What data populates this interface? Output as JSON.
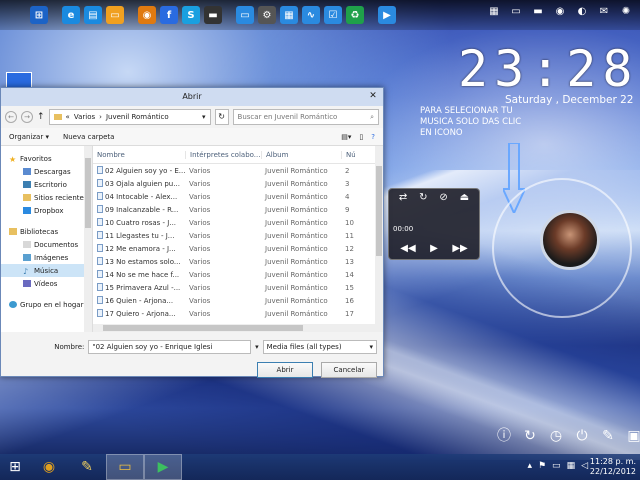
{
  "desktop": {
    "clock": "23:28",
    "date": "Saturday , December 22",
    "note_lines": [
      "PARA SELECIONAR TU",
      "MUSICA SOLO DAS CLIC",
      "EN ICONO"
    ]
  },
  "player": {
    "time": "00:00"
  },
  "dialog": {
    "title": "Abrir",
    "close": "✕",
    "address": {
      "root": "«",
      "path_1": "Varios",
      "path_2": "Juvenil Romántico"
    },
    "search_placeholder": "Buscar en Juvenil Romántico",
    "toolbar": {
      "organize": "Organizar ▾",
      "new_folder": "Nueva carpeta"
    },
    "nav": {
      "favorites": "Favoritos",
      "downloads": "Descargas",
      "desktop": "Escritorio",
      "recent": "Sitios recientes",
      "dropbox": "Dropbox",
      "libraries": "Bibliotecas",
      "documents": "Documentos",
      "images": "Imágenes",
      "music": "Música",
      "videos": "Vídeos",
      "homegroup": "Grupo en el hogar"
    },
    "columns": {
      "name": "Nombre",
      "artists": "Intérpretes colabo...",
      "album": "Álbum",
      "num": "Nú"
    },
    "files": [
      {
        "name": "02 Alguien soy yo - E...",
        "artist": "Varios",
        "album": "Juvenil Romántico",
        "num": "2"
      },
      {
        "name": "03 Ojala alguien pu...",
        "artist": "Varios",
        "album": "Juvenil Romántico",
        "num": "3"
      },
      {
        "name": "04 Intocable - Alex...",
        "artist": "Varios",
        "album": "Juvenil Romántico",
        "num": "4"
      },
      {
        "name": "09 Inalcanzable - R...",
        "artist": "Varios",
        "album": "Juvenil Romántico",
        "num": "9"
      },
      {
        "name": "10 Cuatro rosas - J...",
        "artist": "Varios",
        "album": "Juvenil Romántico",
        "num": "10"
      },
      {
        "name": "11 Llegastes tu - J...",
        "artist": "Varios",
        "album": "Juvenil Romántico",
        "num": "11"
      },
      {
        "name": "12 Me enamora - J...",
        "artist": "Varios",
        "album": "Juvenil Romántico",
        "num": "12"
      },
      {
        "name": "13 No estamos solo...",
        "artist": "Varios",
        "album": "Juvenil Romántico",
        "num": "13"
      },
      {
        "name": "14 No se me hace f...",
        "artist": "Varios",
        "album": "Juvenil Romántico",
        "num": "14"
      },
      {
        "name": "15 Primavera Azul -...",
        "artist": "Varios",
        "album": "Juvenil Romántico",
        "num": "15"
      },
      {
        "name": "16 Quien - Arjona...",
        "artist": "Varios",
        "album": "Juvenil Romántico",
        "num": "16"
      },
      {
        "name": "17 Quiero - Arjona...",
        "artist": "Varios",
        "album": "Juvenil Romántico",
        "num": "17"
      }
    ],
    "filename_label": "Nombre:",
    "filename_value": "\"02 Alguien soy yo - Enrique Iglesi",
    "filter": "Media files (all types)",
    "open_button": "Abrir",
    "cancel_button": "Cancelar"
  },
  "taskbar": {
    "time": "11:28 p. m.",
    "date": "22/12/2012"
  },
  "colors": {
    "accent": "#3c7fb1",
    "selection": "#cce4f7",
    "title_bar": "#cfdcf1"
  }
}
